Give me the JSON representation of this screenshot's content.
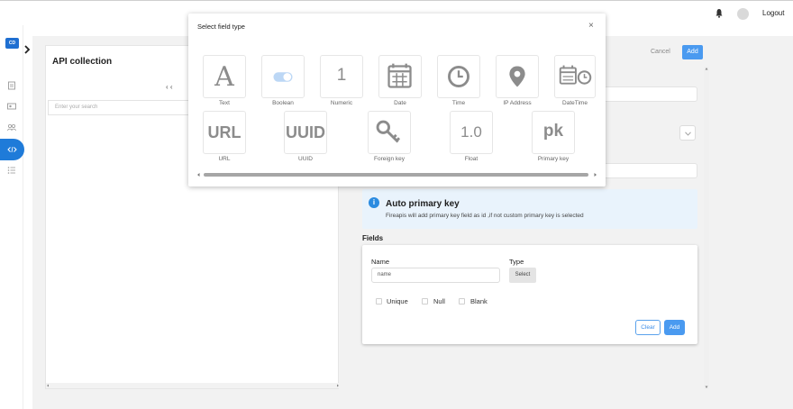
{
  "topbar": {
    "logout_label": "Logout",
    "bell_icon": "bell-icon",
    "avatar_icon": "avatar"
  },
  "rail": {
    "logo_text": "CD",
    "icons": [
      "clipboard-icon",
      "id-card-icon",
      "users-icon",
      "code-icon",
      "list-icon"
    ],
    "active_color": "#1f7bd9"
  },
  "left_panel": {
    "title": "API collection",
    "pager": "‹ ‹",
    "search_placeholder": "Enter your search"
  },
  "right_panel": {
    "cancel_label": "Cancel",
    "add_label": "Add",
    "info": {
      "icon_glyph": "i",
      "title": "Auto primary key",
      "description": "Fireapis will add primary key field as id ,if not custom primary key is selected"
    },
    "fields_label": "Fields",
    "fields_card": {
      "name_label": "Name",
      "type_label": "Type",
      "name_value": "name",
      "select_label": "Select",
      "checkboxes": [
        "Unique",
        "Null",
        "Blank"
      ],
      "clear_label": "Clear",
      "add_label": "Add"
    }
  },
  "modal": {
    "title": "Select field type",
    "close_glyph": "×",
    "tiles": [
      {
        "label": "Text",
        "glyph": "A",
        "icon": "text-icon"
      },
      {
        "label": "Boolean",
        "glyph": "",
        "icon": "toggle-icon"
      },
      {
        "label": "Numeric",
        "glyph": "1",
        "icon": "numeric-icon"
      },
      {
        "label": "Date",
        "glyph": "",
        "icon": "calendar-icon"
      },
      {
        "label": "Time",
        "glyph": "",
        "icon": "clock-icon"
      },
      {
        "label": "IP Address",
        "glyph": "",
        "icon": "map-pin-icon"
      },
      {
        "label": "DateTime",
        "glyph": "",
        "icon": "calendar-clock-icon"
      },
      {
        "label": "URL",
        "glyph": "URL",
        "icon": "url-icon"
      },
      {
        "label": "UUID",
        "glyph": "UUID",
        "icon": "uuid-icon"
      },
      {
        "label": "Foreign key",
        "glyph": "",
        "icon": "key-icon"
      },
      {
        "label": "Float",
        "glyph": "1.0",
        "icon": "float-icon"
      },
      {
        "label": "Primary key",
        "glyph": "pk",
        "icon": "pk-icon"
      }
    ]
  },
  "colors": {
    "accent": "#4a9af0",
    "info_bg": "#e9f3fc",
    "info_icon": "#2b8be0"
  }
}
